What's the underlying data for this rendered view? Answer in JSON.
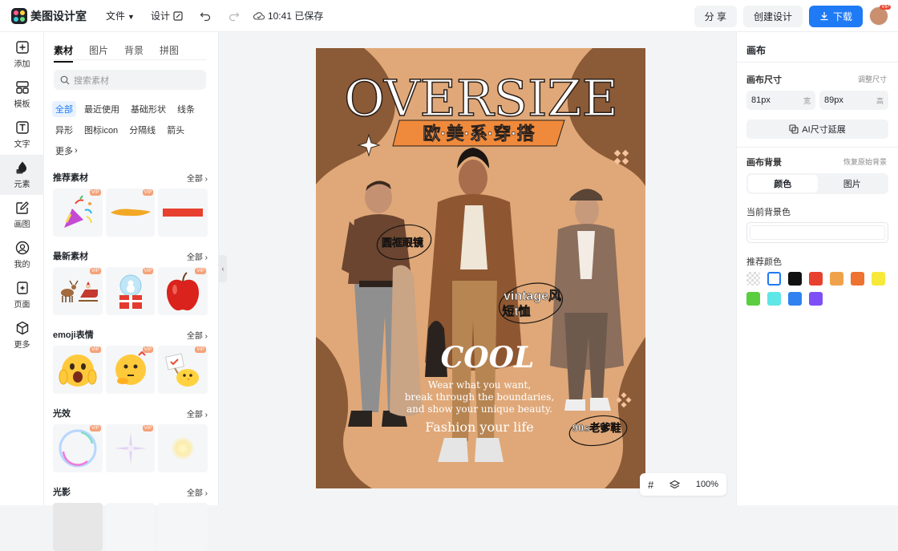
{
  "app": {
    "name": "美图设计室"
  },
  "topbar": {
    "file_menu": "文件",
    "design_menu": "设计",
    "save_status": "10:41 已保存",
    "share_label": "分 享",
    "create_label": "创建设计",
    "download_label": "下载",
    "avatar_badge": "VIP"
  },
  "sidenav": [
    {
      "label": "添加",
      "icon": "plus-square-icon"
    },
    {
      "label": "模板",
      "icon": "template-icon"
    },
    {
      "label": "文字",
      "icon": "text-icon"
    },
    {
      "label": "元素",
      "icon": "shapes-icon"
    },
    {
      "label": "画图",
      "icon": "edit-icon"
    },
    {
      "label": "我的",
      "icon": "user-icon"
    },
    {
      "label": "页面",
      "icon": "page-icon"
    },
    {
      "label": "更多",
      "icon": "cube-icon"
    }
  ],
  "panel": {
    "tabs": [
      "素材",
      "图片",
      "背景",
      "拼图"
    ],
    "search_placeholder": "搜索素材",
    "chips": [
      "全部",
      "最近使用",
      "基础形状",
      "线条",
      "异形",
      "图标icon",
      "分隔线",
      "箭头",
      "更多"
    ],
    "more_label": "全部",
    "vip": "VIP",
    "sections": [
      {
        "title": "推荐素材"
      },
      {
        "title": "最新素材"
      },
      {
        "title": "emoji表情"
      },
      {
        "title": "光效"
      },
      {
        "title": "光影"
      }
    ]
  },
  "canvas": {
    "title": "OVERSIZE",
    "subtitle": "欧·美·系·穿·搭",
    "label_glasses": "圆框眼镜",
    "label_vintage_1": "vintage风",
    "label_vintage_2": "短t恤",
    "cool": "COOL",
    "slogan_1": "Wear what you want,",
    "slogan_2": "break through the boundaries,",
    "slogan_3": "and show your unique beauty.",
    "fashion": "Fashion your life",
    "label_shoes": "90s老爹鞋"
  },
  "zoom": {
    "level": "100%"
  },
  "rpanel": {
    "title": "画布",
    "size_label": "画布尺寸",
    "adjust_label": "调整尺寸",
    "width_value": "81px",
    "width_unit": "宽",
    "height_value": "89px",
    "height_unit": "高",
    "ai_extend": "AI尺寸延展",
    "bg_label": "画布背景",
    "restore_label": "恢复原始背景",
    "seg_color": "颜色",
    "seg_image": "图片",
    "current_bg": "当前背景色",
    "recommend": "推荐颜色",
    "colors": [
      "#ffffff",
      "#111111",
      "#e8402f",
      "#f0a24a",
      "#ee7230",
      "#f6e93a",
      "#5bce3f",
      "#5fe6e6",
      "#2f82f0",
      "#7d4ff5"
    ]
  }
}
